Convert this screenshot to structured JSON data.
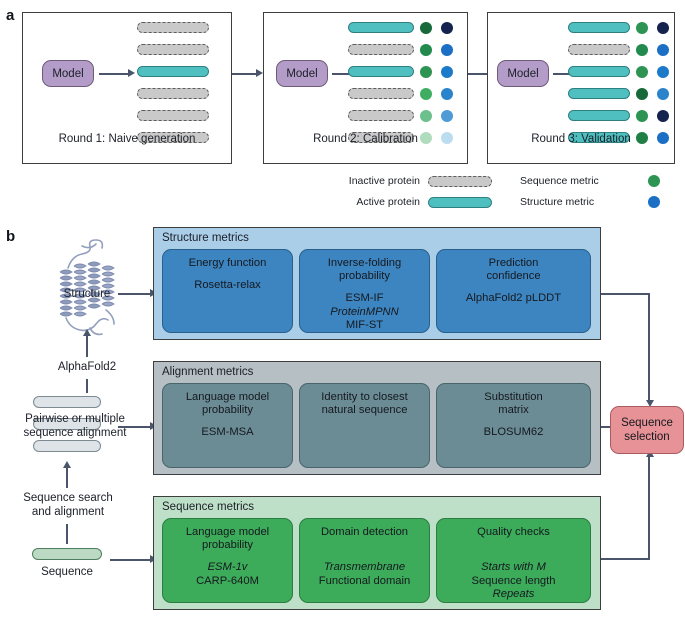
{
  "panels": {
    "a_letter": "a",
    "b_letter": "b"
  },
  "part_a": {
    "rounds": [
      {
        "caption": "Round 1: Naive generation",
        "model_label": "Model",
        "bars": [
          "inactive",
          "inactive",
          "active",
          "inactive",
          "inactive",
          "inactive"
        ],
        "has_metrics": false,
        "sequence_dots": [],
        "structure_dots": []
      },
      {
        "caption": "Round 2: Calibration",
        "model_label": "Model",
        "bars": [
          "active",
          "inactive",
          "active",
          "inactive",
          "inactive",
          "inactive"
        ],
        "has_metrics": true,
        "sequence_dots": [
          "#17693a",
          "#228a4c",
          "#2e9453",
          "#3fae63",
          "#6cc08c",
          "#aedcbc"
        ],
        "structure_dots": [
          "#14244e",
          "#1b6fc4",
          "#1d7ac9",
          "#2b83cc",
          "#4e9bd6",
          "#bcdcf0"
        ]
      },
      {
        "caption": "Round 3: Validation",
        "model_label": "Model",
        "bars": [
          "active",
          "inactive",
          "active",
          "active",
          "active",
          "active"
        ],
        "has_metrics": true,
        "sequence_dots": [
          "#2e9453",
          "#228a4c",
          "#2e9453",
          "#17693a",
          "#2e9453",
          "#1f7f45"
        ],
        "structure_dots": [
          "#14244e",
          "#1b6fc4",
          "#1d7ac9",
          "#2b83cc",
          "#14244e",
          "#1b6fc4"
        ]
      }
    ],
    "legend": [
      {
        "label": "Inactive protein",
        "swatch": "bar-inactive"
      },
      {
        "label": "Active protein",
        "swatch": "bar-active"
      },
      {
        "label": "Sequence metric",
        "swatch": "dot-sequence",
        "color": "#2e9453"
      },
      {
        "label": "Structure metric",
        "swatch": "dot-structure",
        "color": "#1b6fc4"
      }
    ]
  },
  "part_b": {
    "pipeline": {
      "structure_label": "Structure",
      "alphafold_label": "AlphaFold2",
      "msa_label": "Pairwise or multiple\nsequence alignment",
      "msa_label_line1": "Pairwise or multiple",
      "msa_label_line2": "sequence alignment",
      "search_label_line1": "Sequence search",
      "search_label_line2": "and alignment",
      "sequence_label": "Sequence"
    },
    "groups": [
      {
        "title": "Structure metrics",
        "cards": [
          {
            "title_line1": "Energy function",
            "title_line2": "",
            "items": [
              {
                "text": "Rosetta-relax",
                "italic": false
              }
            ]
          },
          {
            "title_line1": "Inverse-folding",
            "title_line2": "probability",
            "items": [
              {
                "text": "ESM-IF",
                "italic": false
              },
              {
                "text": "ProteinMPNN",
                "italic": true
              },
              {
                "text": "MIF-ST",
                "italic": false
              }
            ]
          },
          {
            "title_line1": "Prediction",
            "title_line2": "confidence",
            "items": [
              {
                "text": "AlphaFold2 pLDDT",
                "italic": false
              }
            ]
          }
        ]
      },
      {
        "title": "Alignment metrics",
        "cards": [
          {
            "title_line1": "Language model",
            "title_line2": "probability",
            "items": [
              {
                "text": "ESM-MSA",
                "italic": false
              }
            ]
          },
          {
            "title_line1": "Identity to closest",
            "title_line2": "natural sequence",
            "items": []
          },
          {
            "title_line1": "Substitution",
            "title_line2": "matrix",
            "items": [
              {
                "text": "BLOSUM62",
                "italic": false
              }
            ]
          }
        ]
      },
      {
        "title": "Sequence metrics",
        "cards": [
          {
            "title_line1": "Language model",
            "title_line2": "probability",
            "items": [
              {
                "text": "ESM-1v",
                "italic": true
              },
              {
                "text": "CARP-640M",
                "italic": false
              }
            ]
          },
          {
            "title_line1": "Domain detection",
            "title_line2": "",
            "items": [
              {
                "text": "Transmembrane",
                "italic": true
              },
              {
                "text": "Functional domain",
                "italic": false
              }
            ]
          },
          {
            "title_line1": "Quality checks",
            "title_line2": "",
            "items": [
              {
                "text": "Starts with M",
                "italic": true
              },
              {
                "text": "Sequence length",
                "italic": false
              },
              {
                "text": "Repeats",
                "italic": true
              }
            ]
          }
        ]
      }
    ],
    "selection": {
      "line1": "Sequence",
      "line2": "selection"
    }
  },
  "colors": {
    "active_protein": "#4fc0bf",
    "inactive_protein": "#c9c9c9",
    "model_pill": "#b49cc8",
    "structure_group": "#aacde8",
    "structure_card": "#3d85c0",
    "alignment_group": "#b5bfc4",
    "alignment_card": "#6b8b95",
    "sequence_group": "#bfe0c8",
    "sequence_card": "#3cab5a",
    "selection_box": "#e69296",
    "arrow": "#4a556b"
  }
}
